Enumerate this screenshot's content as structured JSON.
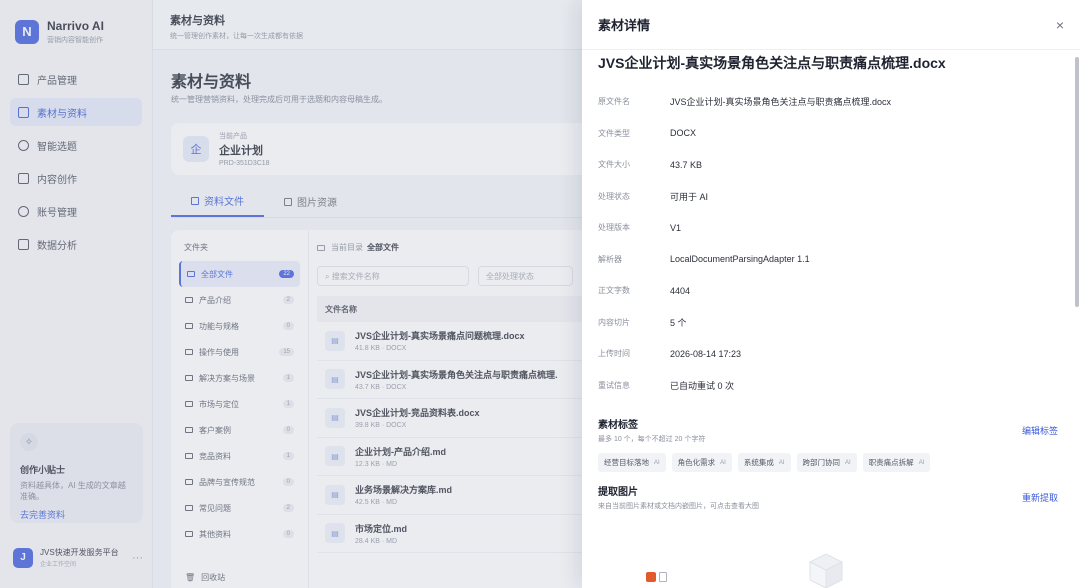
{
  "brand": {
    "logo_letter": "N",
    "name": "Narrivo AI",
    "subtitle": "营销内容智能创作"
  },
  "nav": [
    {
      "label": "产品管理",
      "icon": "box-icon",
      "active": false
    },
    {
      "label": "素材与资料",
      "icon": "folder-icon",
      "active": true
    },
    {
      "label": "智能选题",
      "icon": "lightbulb-icon",
      "active": false
    },
    {
      "label": "内容创作",
      "icon": "document-icon",
      "active": false
    },
    {
      "label": "账号管理",
      "icon": "account-icon",
      "active": false
    },
    {
      "label": "数据分析",
      "icon": "chart-icon",
      "active": false
    }
  ],
  "tip": {
    "icon": "sparkle-icon",
    "title": "创作小贴士",
    "text": "资料越具体，AI 生成的文章越准确。",
    "link": "去完善资料"
  },
  "user": {
    "avatar_letter": "J",
    "name": "JVS快速开发服务平台",
    "sub": "企业工作空间",
    "more": "···"
  },
  "topbar": {
    "title": "素材与资料",
    "subtitle": "统一管理创作素材，让每一次生成都有依据"
  },
  "page": {
    "title": "素材与资料",
    "subtitle": "统一管理营销资料，处理完成后可用于选题和内容母稿生成。"
  },
  "product": {
    "icon_char": "企",
    "label": "当前产品",
    "name": "企业计划",
    "code": "PRD-351D3C18"
  },
  "tabs": [
    {
      "label": "资料文件",
      "active": true
    },
    {
      "label": "图片资源",
      "active": false
    }
  ],
  "folders": {
    "heading": "文件夹",
    "items": [
      {
        "label": "全部文件",
        "count": "22",
        "active": true
      },
      {
        "label": "产品介绍",
        "count": "2"
      },
      {
        "label": "功能与规格",
        "count": "0"
      },
      {
        "label": "操作与使用",
        "count": "15"
      },
      {
        "label": "解决方案与场景",
        "count": "1"
      },
      {
        "label": "市场与定位",
        "count": "1"
      },
      {
        "label": "客户案例",
        "count": "0"
      },
      {
        "label": "竞品资料",
        "count": "1"
      },
      {
        "label": "品牌与宣传规范",
        "count": "0"
      },
      {
        "label": "常见问题",
        "count": "2"
      },
      {
        "label": "其他资料",
        "count": "0"
      }
    ],
    "recycle": "回收站"
  },
  "files": {
    "crumb_prefix": "当前目录",
    "crumb_current": "全部文件",
    "search_placeholder": "搜索文件名称",
    "filter_placeholder": "全部处理状态",
    "column_name": "文件名称",
    "rows": [
      {
        "name": "JVS企业计划-真实场景痛点问题梳理.docx",
        "meta": "41.8 KB · DOCX"
      },
      {
        "name": "JVS企业计划-真实场景角色关注点与职责痛点梳理.",
        "meta": "43.7 KB · DOCX"
      },
      {
        "name": "JVS企业计划-竞品资料表.docx",
        "meta": "39.8 KB · DOCX"
      },
      {
        "name": "企业计划-产品介绍.md",
        "meta": "12.3 KB · MD"
      },
      {
        "name": "业务场景解决方案库.md",
        "meta": "42.5 KB · MD"
      },
      {
        "name": "市场定位.md",
        "meta": "28.4 KB · MD"
      }
    ]
  },
  "drawer": {
    "title": "素材详情",
    "close_icon": "×",
    "doc_title": "JVS企业计划-真实场景角色关注点与职责痛点梳理.docx",
    "properties": [
      {
        "label": "原文件名",
        "value": "JVS企业计划-真实场景角色关注点与职责痛点梳理.docx"
      },
      {
        "label": "文件类型",
        "value": "DOCX"
      },
      {
        "label": "文件大小",
        "value": "43.7 KB"
      },
      {
        "label": "处理状态",
        "value": "可用于 AI"
      },
      {
        "label": "处理版本",
        "value": "V1"
      },
      {
        "label": "解析器",
        "value": "LocalDocumentParsingAdapter 1.1"
      },
      {
        "label": "正文字数",
        "value": "4404"
      },
      {
        "label": "内容切片",
        "value": "5 个"
      },
      {
        "label": "上传时间",
        "value": "2026-08-14 17:23"
      },
      {
        "label": "重试信息",
        "value": "已自动重试 0 次"
      }
    ],
    "tags_section": {
      "title": "素材标签",
      "subtitle": "最多 10 个，每个不超过 20 个字符",
      "action": "编辑标签",
      "tags": [
        {
          "label": "经营目标落地",
          "badge": "AI"
        },
        {
          "label": "角色化需求",
          "badge": "AI"
        },
        {
          "label": "系统集成",
          "badge": "AI"
        },
        {
          "label": "跨部门协同",
          "badge": "AI"
        },
        {
          "label": "职责痛点拆解",
          "badge": "AI"
        }
      ]
    },
    "images_section": {
      "title": "提取图片",
      "subtitle": "来自当前图片素材或文档内嵌图片，可点击查看大图",
      "action": "重新提取"
    }
  },
  "colors": {
    "accent": "#3b5bdb",
    "overlay": "rgba(180,185,200,0.28)"
  }
}
